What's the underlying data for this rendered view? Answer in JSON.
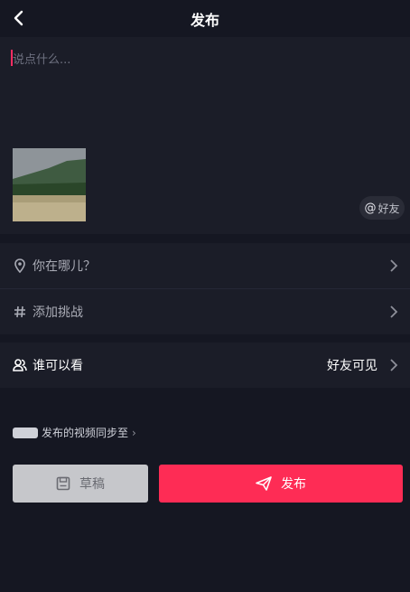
{
  "header": {
    "title": "发布"
  },
  "compose": {
    "placeholder": "说点什么...",
    "friend_chip": "好友",
    "friend_chip_at": "@"
  },
  "options": {
    "location": "你在哪儿？",
    "challenge": "添加挑战",
    "visibility_label": "谁可以看",
    "visibility_value": "好友可见"
  },
  "sync": {
    "text": "发布的视频同步至",
    "arrow": "›"
  },
  "actions": {
    "draft_label": "草稿",
    "publish_label": "发布"
  },
  "colors": {
    "accent": "#fe2c55",
    "background": "#151722",
    "panel": "#1b1d28",
    "draft_button": "#c6c7cb"
  }
}
